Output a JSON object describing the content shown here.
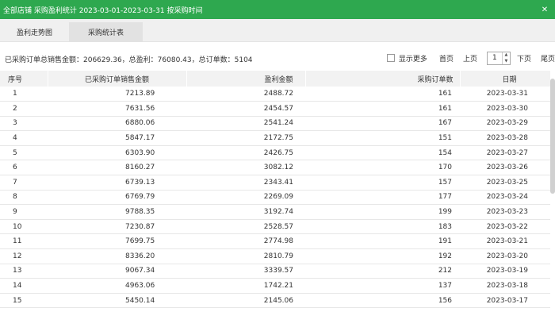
{
  "window": {
    "title": "全部店铺 采购盈利统计 2023-03-01-2023-03-31 按采购时间"
  },
  "tabs": [
    {
      "label": "盈利走势图"
    },
    {
      "label": "采购统计表"
    }
  ],
  "summary": {
    "text": "已采购订单总销售金额：206629.36，总盈利：76080.43，总订单数：5104"
  },
  "pager": {
    "show_more_label": "显示更多",
    "first": "首页",
    "prev": "上页",
    "page": "1",
    "next": "下页",
    "last": "尾页"
  },
  "table": {
    "columns": [
      "序号",
      "已采购订单销售金额",
      "盈利金额",
      "采购订单数",
      "日期"
    ],
    "rows": [
      [
        "1",
        "7213.89",
        "2488.72",
        "161",
        "2023-03-31"
      ],
      [
        "2",
        "7631.56",
        "2454.57",
        "161",
        "2023-03-30"
      ],
      [
        "3",
        "6880.06",
        "2541.24",
        "167",
        "2023-03-29"
      ],
      [
        "4",
        "5847.17",
        "2172.75",
        "151",
        "2023-03-28"
      ],
      [
        "5",
        "6303.90",
        "2426.75",
        "154",
        "2023-03-27"
      ],
      [
        "6",
        "8160.27",
        "3082.12",
        "170",
        "2023-03-26"
      ],
      [
        "7",
        "6739.13",
        "2343.41",
        "157",
        "2023-03-25"
      ],
      [
        "8",
        "6769.79",
        "2269.09",
        "177",
        "2023-03-24"
      ],
      [
        "9",
        "9788.35",
        "3192.74",
        "199",
        "2023-03-23"
      ],
      [
        "10",
        "7230.87",
        "2528.57",
        "183",
        "2023-03-22"
      ],
      [
        "11",
        "7699.75",
        "2774.98",
        "191",
        "2023-03-21"
      ],
      [
        "12",
        "8336.20",
        "2810.79",
        "192",
        "2023-03-20"
      ],
      [
        "13",
        "9067.34",
        "3339.57",
        "212",
        "2023-03-19"
      ],
      [
        "14",
        "4963.06",
        "1742.21",
        "137",
        "2023-03-18"
      ],
      [
        "15",
        "5450.14",
        "2145.06",
        "156",
        "2023-03-17"
      ]
    ]
  },
  "theme": {
    "titlebar_color": "#2ea84f"
  }
}
